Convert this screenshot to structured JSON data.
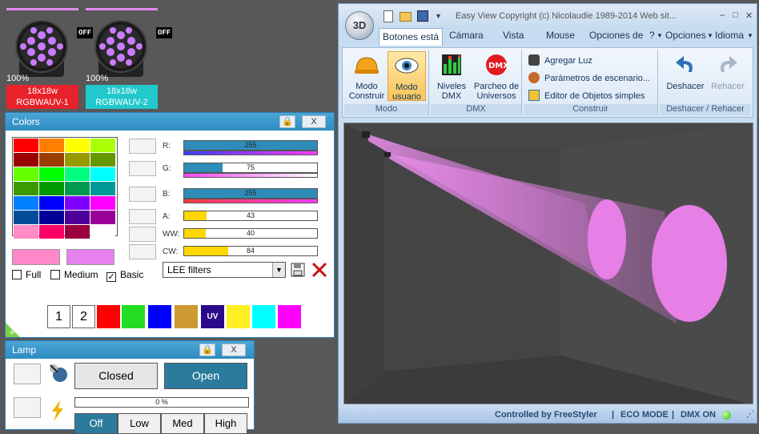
{
  "fixtures": [
    {
      "status": "OFF",
      "level": "100%",
      "model": "18x18w",
      "name": "RGBWAUV-1",
      "label_color": "#e8222c"
    },
    {
      "status": "OFF",
      "level": "100%",
      "model": "18x18w",
      "name": "RGBWAUV-2",
      "label_color": "#22c9cc"
    }
  ],
  "colors_panel": {
    "title": "Colors",
    "close_label": "X",
    "palette": [
      "#ff0000",
      "#ff7f00",
      "#ffff00",
      "#aaff00",
      "#990000",
      "#993d00",
      "#999900",
      "#669900",
      "#66ff00",
      "#00ff00",
      "#00ff7f",
      "#00ffff",
      "#3d9900",
      "#009900",
      "#00994d",
      "#009999",
      "#007fff",
      "#0000ff",
      "#7f00ff",
      "#ff00ff",
      "#004c99",
      "#000099",
      "#4c0099",
      "#990099",
      "#ff8cc6",
      "#ff0066",
      "#99003d",
      "#ffffff"
    ],
    "current_color": "#ff88c8",
    "previous_color": "#e682f0",
    "palette_modes": {
      "full": "Full",
      "medium": "Medium",
      "basic": "Basic"
    },
    "channels": [
      {
        "label": "R:",
        "value": "255",
        "level": 1.0,
        "color": "#2f8cb8"
      },
      {
        "label": "G:",
        "value": "75",
        "level": 0.29,
        "color": "#2f8cb8"
      },
      {
        "label": "B:",
        "value": "255",
        "level": 1.0,
        "color": "#2f8cb8"
      },
      {
        "label": "A:",
        "value": "43",
        "level": 0.17,
        "color": "#ffd700"
      },
      {
        "label": "WW:",
        "value": "40",
        "level": 0.16,
        "color": "#ffd700"
      },
      {
        "label": "CW:",
        "value": "84",
        "level": 0.33,
        "color": "#ffd700"
      }
    ],
    "filter_select": "LEE filters",
    "presets": [
      {
        "kind": "num",
        "label": "1"
      },
      {
        "kind": "num",
        "label": "2"
      },
      {
        "kind": "color",
        "color": "#ff0000"
      },
      {
        "kind": "color",
        "color": "#22dd22"
      },
      {
        "kind": "color",
        "color": "#0000ff"
      },
      {
        "kind": "color",
        "color": "#cc9933"
      },
      {
        "kind": "uv",
        "label": "UV",
        "color": "#2a0a8a"
      },
      {
        "kind": "color",
        "color": "#ffee22"
      },
      {
        "kind": "color",
        "color": "#00ffff"
      },
      {
        "kind": "color",
        "color": "#ff00ff"
      }
    ]
  },
  "lamp_panel": {
    "title": "Lamp",
    "close_label": "X",
    "closed_label": "Closed",
    "open_label": "Open",
    "dimmer_value": "0 %",
    "dimmer_level": 0,
    "modes": [
      "Off",
      "Low",
      "Med",
      "High"
    ]
  },
  "app": {
    "orb_label": "3D",
    "title": "Easy View   Copyright (c) Nicolaudie 1989-2014   Web sit...",
    "tabs": [
      "Botones está",
      "Cámara",
      "Vista",
      "Mouse",
      "Opciones de",
      "?",
      "Opciones",
      "Idioma"
    ],
    "groups": {
      "modo": {
        "label": "Modo",
        "build": "Modo Construir",
        "user": "Modo usuario"
      },
      "dmx": {
        "label": "DMX",
        "levels": "Niveles DMX",
        "patch": "Parcheo de Universos"
      },
      "construir": {
        "label": "Construir",
        "add_light": "Agregar Luz",
        "scene_params": "Parámetros de escenario...",
        "object_editor": "Editor de Objetos simples"
      },
      "undo": {
        "label": "Deshacer / Rehacer",
        "undo": "Deshacer",
        "redo": "Rehacer"
      }
    },
    "status": {
      "controlled": "Controlled by FreeStyler",
      "eco": "ECO MODE",
      "dmx": "DMX ON"
    }
  }
}
